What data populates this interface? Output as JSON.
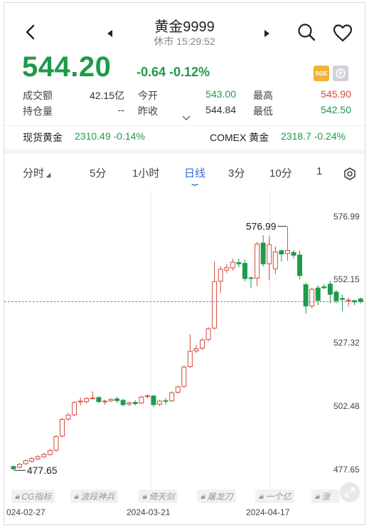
{
  "header": {
    "title": "黄金9999",
    "status": "休市 15:29:52",
    "back_icon": "chevron-left-icon",
    "prev_icon": "triangle-left-icon",
    "next_icon": "triangle-right-icon",
    "search_icon": "search-icon",
    "favorite_icon": "heart-icon"
  },
  "quote": {
    "price": "544.20",
    "change": "-0.64 -0.12%",
    "exchange_badge": "SGE"
  },
  "stats": {
    "volume_label": "成交额",
    "volume_value": "42.15亿",
    "open_label": "今开",
    "open_value": "543.00",
    "high_label": "最高",
    "high_value": "545.90",
    "oi_label": "持仓量",
    "oi_value": "--",
    "prev_label": "昨收",
    "prev_value": "544.84",
    "low_label": "最低",
    "low_value": "542.50"
  },
  "related": {
    "spot_label": "现货黄金",
    "spot_value": "2310.49 -0.14%",
    "comex_label": "COMEX 黄金",
    "comex_value": "2318.7 -0.24%"
  },
  "tabs": [
    "分时",
    "5分",
    "1小时",
    "日线",
    "3分",
    "10分",
    "1"
  ],
  "active_tab": "日线",
  "colors": {
    "up": "#d24b3b",
    "down": "#1f9a4a",
    "accent": "#2e6fd8",
    "last_price_line": "#5b86c9"
  },
  "chart_data": {
    "type": "candlestick",
    "x_ticks": [
      "024-02-27",
      "2024-03-21",
      "2024-04-17"
    ],
    "y_ticks": [
      576.99,
      552.15,
      527.32,
      502.48,
      477.65
    ],
    "ylim": [
      477.65,
      576.99
    ],
    "max_annotation": "576.99",
    "min_annotation": "477.65",
    "last_price": 544.2,
    "candles": [
      [
        479.2,
        478.3,
        479.6,
        477.65
      ],
      [
        478.9,
        480.1,
        480.6,
        478.5
      ],
      [
        480.3,
        481.5,
        482.0,
        479.9
      ],
      [
        481.3,
        482.4,
        482.9,
        480.8
      ],
      [
        482.2,
        483.1,
        483.7,
        481.7
      ],
      [
        483.0,
        484.0,
        484.6,
        482.6
      ],
      [
        483.9,
        485.5,
        486.2,
        483.5
      ],
      [
        485.6,
        491.0,
        491.6,
        485.1
      ],
      [
        491.2,
        497.8,
        498.4,
        490.7
      ],
      [
        497.9,
        499.5,
        500.2,
        497.2
      ],
      [
        499.6,
        504.5,
        505.0,
        499.0
      ],
      [
        504.7,
        505.0,
        506.4,
        503.3
      ],
      [
        504.8,
        506.0,
        506.6,
        504.0
      ],
      [
        506.1,
        506.2,
        508.8,
        505.7
      ],
      [
        506.4,
        504.8,
        506.9,
        504.1
      ],
      [
        504.9,
        505.0,
        505.6,
        503.6
      ],
      [
        505.1,
        505.7,
        506.2,
        504.6
      ],
      [
        505.9,
        505.2,
        506.7,
        504.4
      ],
      [
        505.3,
        503.6,
        505.9,
        502.9
      ],
      [
        503.8,
        504.3,
        504.8,
        503.1
      ],
      [
        504.5,
        504.0,
        505.3,
        503.3
      ],
      [
        504.2,
        506.6,
        507.1,
        503.8
      ],
      [
        506.8,
        507.1,
        507.7,
        506.1
      ],
      [
        507.0,
        503.6,
        507.5,
        502.7
      ],
      [
        503.8,
        505.0,
        505.6,
        503.1
      ],
      [
        505.2,
        504.9,
        506.2,
        503.6
      ],
      [
        505.1,
        508.3,
        508.8,
        504.7
      ],
      [
        508.5,
        510.6,
        511.1,
        507.9
      ],
      [
        510.8,
        518.4,
        519.1,
        510.2
      ],
      [
        518.6,
        524.6,
        531.3,
        518.0
      ],
      [
        524.8,
        525.6,
        527.2,
        523.9
      ],
      [
        525.9,
        529.1,
        529.8,
        525.2
      ],
      [
        529.3,
        533.5,
        534.2,
        528.4
      ],
      [
        533.8,
        552.1,
        560.0,
        533.2
      ],
      [
        552.3,
        557.0,
        558.2,
        547.6
      ],
      [
        556.6,
        557.6,
        559.0,
        555.5
      ],
      [
        557.5,
        559.8,
        561.1,
        556.4
      ],
      [
        559.6,
        559.1,
        561.2,
        557.7
      ],
      [
        559.3,
        553.3,
        560.8,
        552.2
      ],
      [
        553.6,
        553.5,
        554.2,
        549.5
      ],
      [
        553.5,
        566.9,
        567.8,
        550.3
      ],
      [
        567.3,
        559.1,
        570.4,
        558.0
      ],
      [
        559.2,
        566.7,
        570.0,
        552.6
      ],
      [
        557.2,
        563.8,
        566.0,
        555.1
      ],
      [
        564.3,
        563.0,
        564.8,
        560.0
      ],
      [
        563.2,
        564.4,
        573.9,
        560.3
      ],
      [
        563.6,
        562.5,
        564.6,
        561.1
      ],
      [
        562.6,
        554.5,
        564.3,
        553.0
      ],
      [
        550.9,
        542.5,
        551.8,
        539.5
      ],
      [
        542.5,
        549.1,
        549.6,
        541.6
      ],
      [
        549.6,
        544.7,
        550.6,
        542.8
      ],
      [
        550.1,
        549.7,
        551.2,
        549.1
      ],
      [
        551.1,
        547.1,
        552.4,
        543.6
      ],
      [
        548.0,
        544.6,
        548.7,
        543.6
      ],
      [
        545.5,
        545.1,
        547.0,
        540.5
      ],
      [
        544.8,
        544.8,
        545.8,
        542.4
      ],
      [
        544.6,
        544.1,
        545.0,
        542.8
      ],
      [
        545.3,
        544.2,
        545.9,
        543.5
      ]
    ]
  },
  "strategies": [
    "CG指标",
    "波段神兵",
    "倚天剑",
    "屠龙刀",
    "一个亿",
    "涨"
  ],
  "zoom_icon": "expand-icon"
}
